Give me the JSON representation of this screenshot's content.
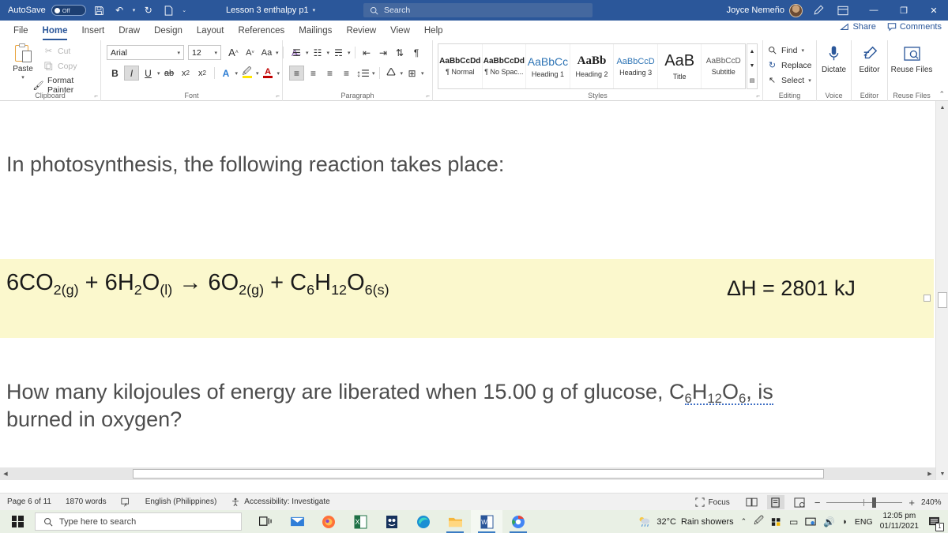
{
  "titlebar": {
    "autosave_label": "AutoSave",
    "autosave_state": "Off",
    "quick_access": [
      "save-icon",
      "undo-icon",
      "redo-icon",
      "new-icon",
      "customize-icon"
    ],
    "document_title": "Lesson 3 enthalpy p1",
    "search_placeholder": "Search",
    "user_name": "Joyce Nemeño",
    "window_buttons": [
      "minimize",
      "restore",
      "close"
    ],
    "accent_color": "#2b579a"
  },
  "tabs": [
    {
      "label": "File",
      "active": false
    },
    {
      "label": "Home",
      "active": true
    },
    {
      "label": "Insert",
      "active": false
    },
    {
      "label": "Draw",
      "active": false
    },
    {
      "label": "Design",
      "active": false
    },
    {
      "label": "Layout",
      "active": false
    },
    {
      "label": "References",
      "active": false
    },
    {
      "label": "Mailings",
      "active": false
    },
    {
      "label": "Review",
      "active": false
    },
    {
      "label": "View",
      "active": false
    },
    {
      "label": "Help",
      "active": false
    }
  ],
  "share_bar": {
    "share_label": "Share",
    "comments_label": "Comments"
  },
  "ribbon": {
    "clipboard": {
      "group_label": "Clipboard",
      "paste_label": "Paste",
      "cut_label": "Cut",
      "copy_label": "Copy",
      "format_painter_label": "Format Painter"
    },
    "font": {
      "group_label": "Font",
      "font_name": "Arial",
      "font_size": "12",
      "grow_label": "A",
      "shrink_label": "A",
      "change_case_label": "Aa",
      "bold_label": "B",
      "italic_label": "I",
      "underline_label": "U",
      "strikethrough_label": "ab",
      "subscript_label": "x",
      "superscript_label": "x",
      "text_effects_label": "A",
      "highlight_label": "",
      "font_color_label": "A",
      "italic_active": true
    },
    "paragraph": {
      "group_label": "Paragraph"
    },
    "styles": {
      "group_label": "Styles",
      "items": [
        {
          "preview": "AaBbCcDd",
          "name": "¶ Normal"
        },
        {
          "preview": "AaBbCcDd",
          "name": "¶ No Spac..."
        },
        {
          "preview": "AaBbCc",
          "name": "Heading 1"
        },
        {
          "preview": "AaBb",
          "name": "Heading 2"
        },
        {
          "preview": "AaBbCcD",
          "name": "Heading 3"
        },
        {
          "preview": "AaB",
          "name": "Title"
        },
        {
          "preview": "AaBbCcD",
          "name": "Subtitle"
        }
      ]
    },
    "editing": {
      "group_label": "Editing",
      "find_label": "Find",
      "replace_label": "Replace",
      "select_label": "Select"
    },
    "voice": {
      "group_label": "Voice",
      "dictate_label": "Dictate"
    },
    "editor": {
      "group_label": "Editor",
      "editor_label": "Editor"
    },
    "reuse": {
      "group_label": "Reuse Files",
      "reuse_label": "Reuse Files"
    }
  },
  "document": {
    "intro_line": "In photosynthesis, the following reaction takes place:",
    "equation": {
      "highlight_color": "#fbf8cd",
      "reactant_1_coeff": "6",
      "reactant_1_formula": "CO",
      "reactant_1_sub": "2(g)",
      "plus_1": "+",
      "reactant_2_coeff": "6",
      "reactant_2_formula_a": "H",
      "reactant_2_sub_a": "2",
      "reactant_2_formula_b": "O",
      "reactant_2_sub_b": "(l)",
      "arrow": "→",
      "product_1_coeff": "6",
      "product_1_formula": "O",
      "product_1_sub": "2(g)",
      "plus_2": "+",
      "product_2_formula_a": "C",
      "product_2_sub_a": "6",
      "product_2_formula_b": "H",
      "product_2_sub_b": "12",
      "product_2_formula_c": "O",
      "product_2_sub_c": "6(s)",
      "enthalpy": "ΔH = 2801 kJ"
    },
    "question_line_1_a": "How many kilojoules of energy are liberated when 15.00 g of glucose, C",
    "question_line_1_sub_1": "6",
    "question_line_1_b": "H",
    "question_line_1_sub_2": "12",
    "question_line_1_c": "O",
    "question_line_1_sub_3": "6",
    "question_line_1_d": ", is",
    "question_line_2": "burned in oxygen?"
  },
  "status_bar": {
    "page": "Page 6 of 11",
    "words": "1870 words",
    "proofing_icon": "spelling-check-icon",
    "language": "English (Philippines)",
    "accessibility": "Accessibility: Investigate",
    "focus_label": "Focus",
    "zoom_level": "240%",
    "zoom_out": "−",
    "zoom_in": "+"
  },
  "taskbar": {
    "search_placeholder": "Type here to search",
    "apps": [
      {
        "name": "task-view",
        "glyph": "❏"
      },
      {
        "name": "mail",
        "glyph": "✉"
      },
      {
        "name": "firefox",
        "glyph": "●"
      },
      {
        "name": "excel",
        "glyph": "X"
      },
      {
        "name": "app-blue",
        "glyph": "▣"
      },
      {
        "name": "edge",
        "glyph": "◉"
      },
      {
        "name": "file-explorer",
        "glyph": "🗀"
      },
      {
        "name": "word",
        "glyph": "W"
      },
      {
        "name": "chrome",
        "glyph": "◍"
      }
    ],
    "weather_temp": "32°C",
    "weather_desc": "Rain showers",
    "language": "ENG",
    "time": "12:05 pm",
    "date": "01/11/2021",
    "notification_count": "1"
  }
}
